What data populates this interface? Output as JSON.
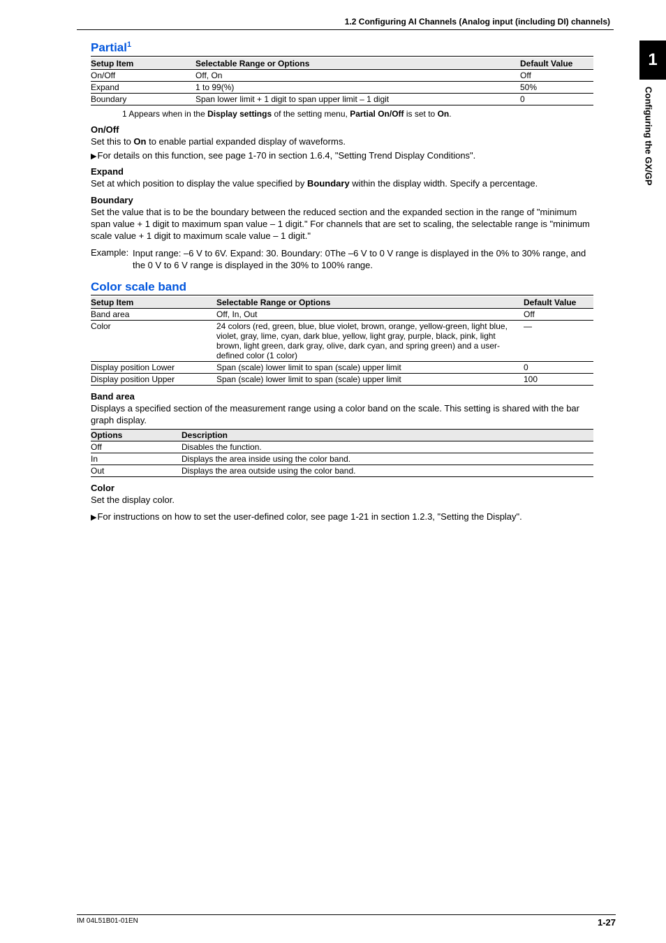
{
  "header": {
    "section": "1.2  Configuring AI Channels (Analog input (including DI) channels)"
  },
  "sidetab": {
    "num": "1",
    "label": "Configuring the GX/GP"
  },
  "partial": {
    "heading": "Partial",
    "sup": "1",
    "th1": "Setup Item",
    "th2": "Selectable Range or Options",
    "th3": "Default Value",
    "rows": [
      {
        "item": "On/Off",
        "range": "Off, On",
        "def": "Off"
      },
      {
        "item": "Expand",
        "range": "1 to 99(%)",
        "def": "50%"
      },
      {
        "item": "Boundary",
        "range": "Span lower limit + 1 digit to span upper limit – 1 digit",
        "def": "0"
      }
    ],
    "footnote": "1  Appears when in the Display settings of the setting menu, Partial On/Off is set to On.",
    "footnote_prefix": "1  Appears when in the ",
    "footnote_b1": "Display settings",
    "footnote_mid": " of the setting menu, ",
    "footnote_b2": "Partial On/Off",
    "footnote_mid2": " is set to ",
    "footnote_b3": "On",
    "footnote_end": ".",
    "onoff": {
      "h": "On/Off",
      "p1a": "Set this to ",
      "p1b": "On",
      "p1c": " to enable partial expanded display of waveforms.",
      "xref": "For details on this function, see page 1-70 in section 1.6.4, \"Setting Trend Display Conditions\"."
    },
    "expand": {
      "h": "Expand",
      "p1a": "Set at which position to display the value specified by ",
      "p1b": "Boundary",
      "p1c": " within the display width. Specify a percentage."
    },
    "boundary": {
      "h": "Boundary",
      "p1": "Set the value that is to be the boundary between the reduced section and the expanded section in the range of \"minimum span value + 1 digit to maximum span value – 1 digit.\" For channels that are set to scaling, the selectable range is \"minimum scale value + 1 digit to maximum scale value – 1 digit.\"",
      "ex_label": "Example: ",
      "ex_body": "Input range: –6 V to 6V. Expand: 30. Boundary: 0The –6 V to 0 V range is displayed in the 0% to 30% range, and the 0 V to 6 V range is displayed in the 30% to 100% range."
    }
  },
  "colorband": {
    "heading": "Color scale band",
    "th1": "Setup Item",
    "th2": "Selectable Range or Options",
    "th3": "Default Value",
    "rows": [
      {
        "item": "Band area",
        "range": "Off, In, Out",
        "def": "Off"
      },
      {
        "item": "Color",
        "range": "24 colors (red, green, blue, blue violet, brown, orange, yellow-green, light blue, violet, gray, lime, cyan, dark blue, yellow, light gray, purple, black, pink, light brown, light green, dark gray, olive, dark cyan, and spring green) and a user-defined color (1 color)",
        "def": "—"
      },
      {
        "item": "Display position Lower",
        "range": "Span (scale) lower limit to span (scale) upper limit",
        "def": "0"
      },
      {
        "item": "Display position Upper",
        "range": "Span (scale) lower limit to span (scale) upper limit",
        "def": "100"
      }
    ],
    "bandarea": {
      "h": "Band area",
      "p": "Displays a specified section of the measurement range using a color band on the scale. This setting is shared with the bar graph display.",
      "th1": "Options",
      "th2": "Description",
      "opts": [
        {
          "o": "Off",
          "d": "Disables the function."
        },
        {
          "o": "In",
          "d": "Displays the area inside using the color band."
        },
        {
          "o": "Out",
          "d": "Displays the area outside using the color band."
        }
      ]
    },
    "color": {
      "h": "Color",
      "p": "Set the display color.",
      "xref": "For instructions on how to set the user-defined color, see page 1-21 in section 1.2.3, \"Setting the Display\"."
    }
  },
  "footer": {
    "left": "IM 04L51B01-01EN",
    "right": "1-27"
  }
}
